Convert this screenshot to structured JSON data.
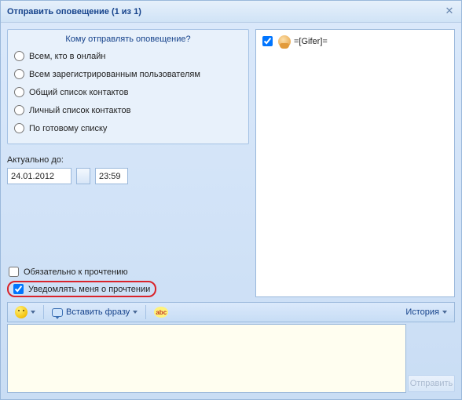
{
  "window": {
    "title": "Отправить оповещение (1 из 1)"
  },
  "group": {
    "title": "Кому отправлять оповещение?",
    "options": [
      "Всем, кто в онлайн",
      "Всем зарегистрированным пользователям",
      "Общий список контактов",
      "Личный список контактов",
      "По готовому списку"
    ]
  },
  "valid_until": {
    "label": "Актуально до:",
    "date": "24.01.2012",
    "time": "23:59"
  },
  "checks": {
    "must_read": {
      "label": "Обязательно к прочтению",
      "checked": false
    },
    "notify_me": {
      "label": "Уведомлять меня о прочтении",
      "checked": true
    }
  },
  "recipients": [
    {
      "name": "=[Gifer]=",
      "checked": true
    }
  ],
  "toolbar": {
    "insert_phrase": "Вставить фразу",
    "abc": "abc",
    "history": "История"
  },
  "compose": {
    "value": ""
  },
  "send": {
    "label": "Отправить"
  }
}
